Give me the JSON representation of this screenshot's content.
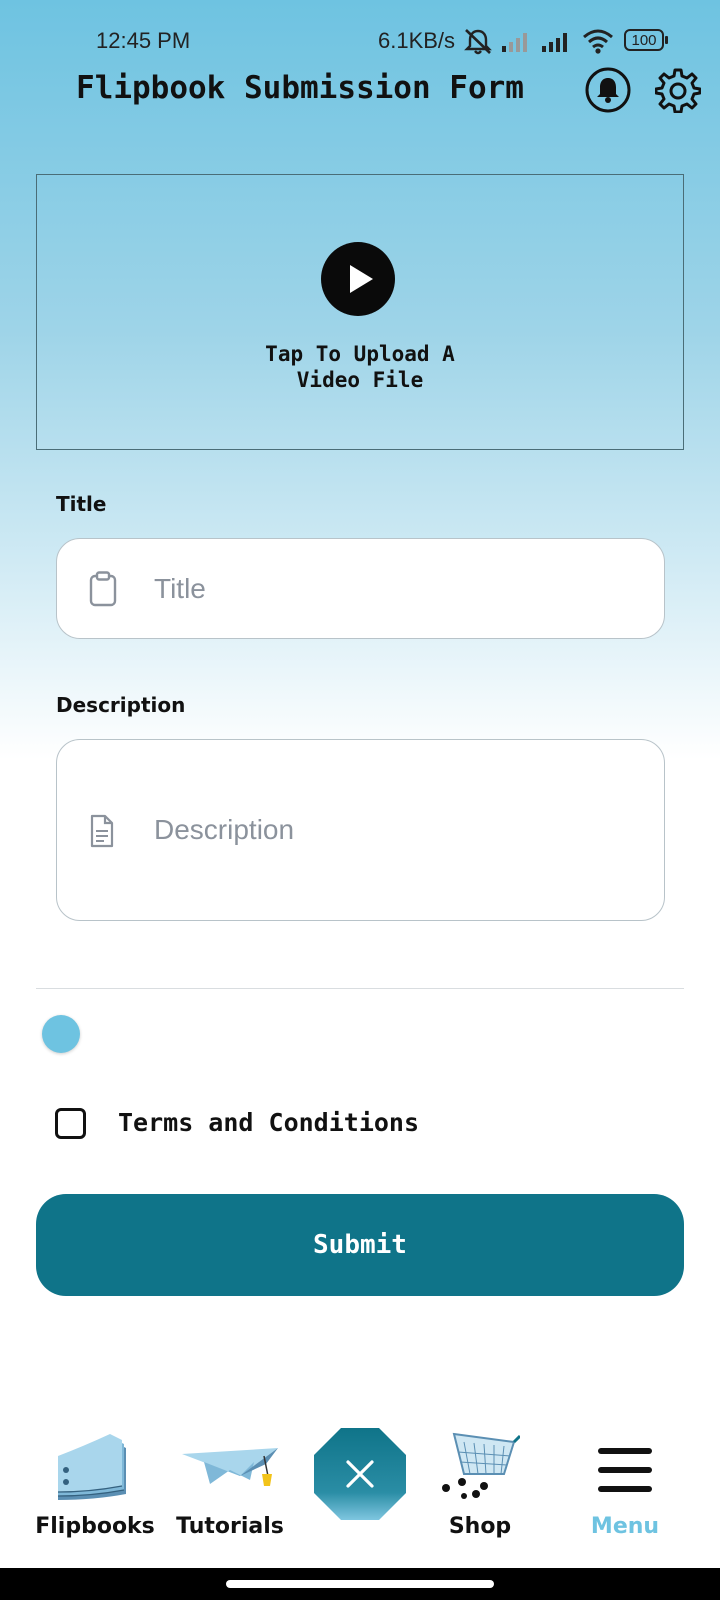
{
  "status_bar": {
    "time": "12:45 PM",
    "net_speed": "6.1KB/s",
    "battery": "100",
    "icons": [
      "mute-bell-icon",
      "signal-icon",
      "signal-icon",
      "wifi-icon",
      "battery-icon"
    ]
  },
  "header": {
    "title": "Flipbook Submission Form",
    "icons": [
      "bell-icon",
      "gear-icon"
    ]
  },
  "upload": {
    "caption": "Tap To Upload A\nVideo File",
    "icon": "play-icon"
  },
  "form": {
    "title_label": "Title",
    "title_placeholder": "Title",
    "description_label": "Description",
    "description_placeholder": "Description",
    "terms_label": "Terms and Conditions",
    "terms_checked": false,
    "submit_label": "Submit"
  },
  "bottom_nav": {
    "items": [
      {
        "label": "Flipbooks",
        "icon": "flipbook-icon"
      },
      {
        "label": "Tutorials",
        "icon": "graduation-cap-icon"
      },
      {
        "label": "",
        "icon": "close-icon"
      },
      {
        "label": "Shop",
        "icon": "cart-icon"
      },
      {
        "label": "Menu",
        "icon": "hamburger-icon",
        "active": true
      }
    ]
  },
  "colors": {
    "accent": "#0f7489",
    "light_accent": "#6ec3e1",
    "header_gradient_top": "#6ec3e1"
  }
}
